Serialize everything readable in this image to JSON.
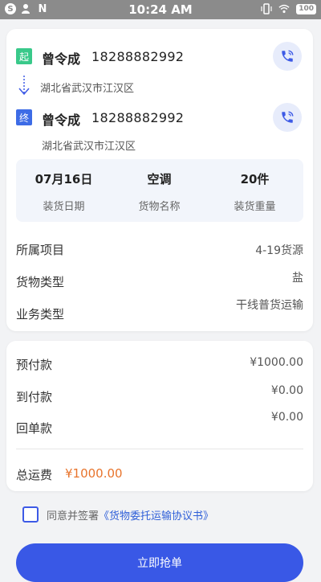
{
  "status_bar": {
    "time": "10:24 AM",
    "battery": "100",
    "left_icons": [
      "s-icon",
      "person-icon",
      "n-icon"
    ],
    "right_icons": [
      "vibrate-icon",
      "wifi-icon",
      "battery-icon"
    ]
  },
  "route": {
    "start": {
      "tag": "起",
      "name": "曾令成",
      "phone": "18288882992",
      "address": "湖北省武汉市江汉区"
    },
    "end": {
      "tag": "终",
      "name": "曾令成",
      "phone": "18288882992",
      "address": "湖北省武汉市江汉区"
    }
  },
  "cargo_summary": [
    {
      "value": "07月16日",
      "label": "装货日期"
    },
    {
      "value": "空调",
      "label": "货物名称"
    },
    {
      "value": "20件",
      "label": "装货重量"
    }
  ],
  "details": [
    {
      "label": "所属项目",
      "value": "4-19货源"
    },
    {
      "label": "货物类型",
      "value": "盐"
    },
    {
      "label": "业务类型",
      "value": "干线普货运输"
    }
  ],
  "payments": [
    {
      "label": "预付款",
      "value": "¥1000.00"
    },
    {
      "label": "到付款",
      "value": "¥0.00"
    },
    {
      "label": "回单款",
      "value": "¥0.00"
    }
  ],
  "total": {
    "label": "总运费",
    "value": "¥1000.00"
  },
  "agreement": {
    "prefix": "同意并签署",
    "link": "《货物委托运输协议书》",
    "checked": false
  },
  "action": {
    "label": "立即抢单"
  },
  "colors": {
    "accent": "#3958e6",
    "start_tag": "#39c98a",
    "end_tag": "#3d6ce6",
    "total_amount": "#e8742c"
  }
}
